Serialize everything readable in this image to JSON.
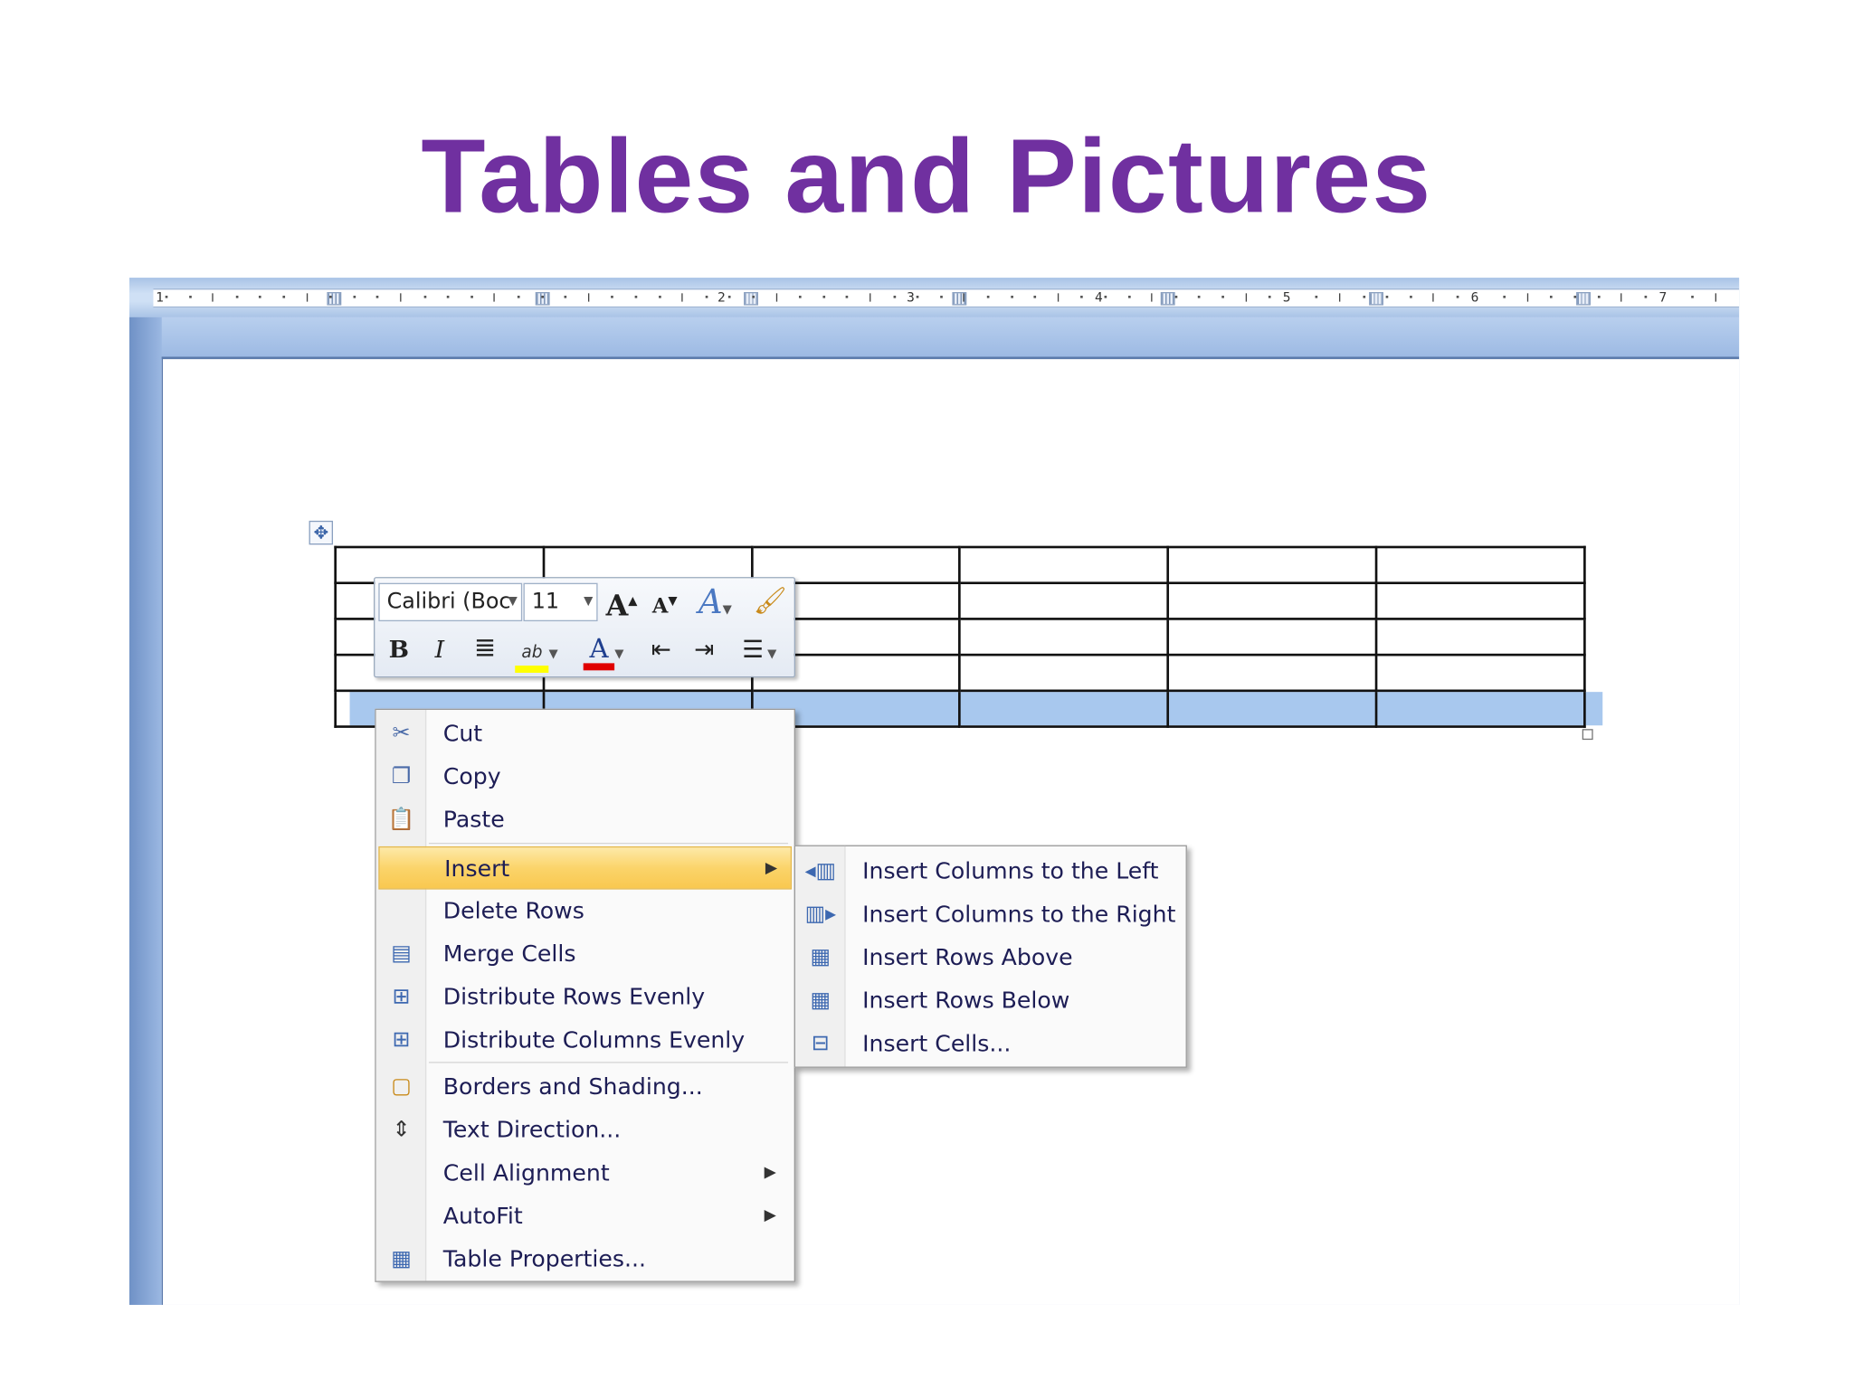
{
  "slide": {
    "title": "Tables and Pictures"
  },
  "ruler": {
    "numbers": [
      "1",
      "2",
      "3",
      "4",
      "5",
      "6",
      "7"
    ]
  },
  "mini_toolbar": {
    "font_name": "Calibri (Boc",
    "font_size": "11",
    "bold": "B",
    "italic": "I",
    "grow_font": "A",
    "shrink_font": "A",
    "highlight": "ab",
    "font_color": "A"
  },
  "context_menu": {
    "items": [
      {
        "label": "Cut",
        "icon": "scissors-icon"
      },
      {
        "label": "Copy",
        "icon": "copy-icon"
      },
      {
        "label": "Paste",
        "icon": "paste-icon"
      },
      {
        "label": "Insert",
        "highlighted": true,
        "submenu": true
      },
      {
        "label": "Delete Rows"
      },
      {
        "label": "Merge Cells",
        "icon": "merge-cells-icon"
      },
      {
        "label": "Distribute Rows Evenly",
        "icon": "distribute-rows-icon"
      },
      {
        "label": "Distribute Columns Evenly",
        "icon": "distribute-columns-icon"
      },
      {
        "label": "Borders and Shading...",
        "icon": "borders-icon"
      },
      {
        "label": "Text Direction...",
        "icon": "text-direction-icon"
      },
      {
        "label": "Cell Alignment",
        "submenu": true
      },
      {
        "label": "AutoFit",
        "submenu": true
      },
      {
        "label": "Table Properties...",
        "icon": "table-properties-icon"
      }
    ]
  },
  "insert_submenu": {
    "items": [
      {
        "label": "Insert Columns to the Left",
        "icon": "insert-columns-left-icon"
      },
      {
        "label": "Insert Columns to the Right",
        "icon": "insert-columns-right-icon"
      },
      {
        "label": "Insert Rows Above",
        "icon": "insert-rows-above-icon"
      },
      {
        "label": "Insert Rows Below",
        "icon": "insert-rows-below-icon"
      },
      {
        "label": "Insert Cells...",
        "icon": "insert-cells-icon"
      }
    ]
  },
  "colors": {
    "title": "#7030a0",
    "selection": "#a8c8ee",
    "menu_highlight": "#fbd46a",
    "window": "#bcd2ee"
  }
}
